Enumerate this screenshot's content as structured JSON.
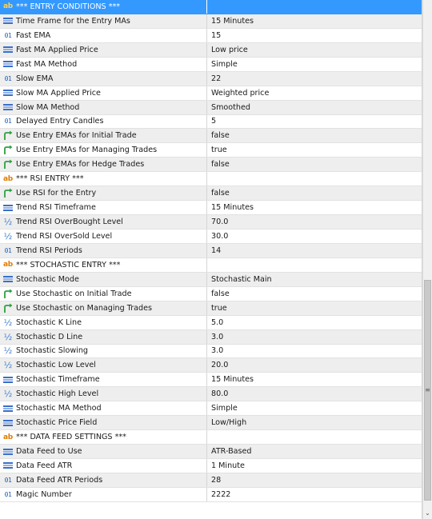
{
  "colors": {
    "selected_row": "#3399ff",
    "alt_row": "#eeeeee",
    "int_icon": "#1e5fb8",
    "bool_icon": "#2ea043",
    "string_icon": "#e07b00"
  },
  "properties": [
    {
      "icon": "string",
      "name": "*** ENTRY CONDITIONS ***",
      "value": "",
      "selected": true
    },
    {
      "icon": "enum",
      "name": "Time Frame for the Entry MAs",
      "value": "15 Minutes"
    },
    {
      "icon": "int",
      "name": "Fast EMA",
      "value": "15"
    },
    {
      "icon": "enum",
      "name": "Fast MA Applied Price",
      "value": "Low price"
    },
    {
      "icon": "enum",
      "name": "Fast MA Method",
      "value": "Simple"
    },
    {
      "icon": "int",
      "name": "Slow EMA",
      "value": "22"
    },
    {
      "icon": "enum",
      "name": "Slow MA Applied Price",
      "value": "Weighted price"
    },
    {
      "icon": "enum",
      "name": "Slow MA Method",
      "value": "Smoothed"
    },
    {
      "icon": "int",
      "name": "Delayed Entry Candles",
      "value": "5"
    },
    {
      "icon": "bool",
      "name": "Use Entry EMAs for Initial Trade",
      "value": "false"
    },
    {
      "icon": "bool",
      "name": "Use Entry EMAs for Managing Trades",
      "value": "true"
    },
    {
      "icon": "bool",
      "name": "Use Entry EMAs for Hedge Trades",
      "value": "false"
    },
    {
      "icon": "string",
      "name": "*** RSI ENTRY ***",
      "value": ""
    },
    {
      "icon": "bool",
      "name": "Use RSI for the Entry",
      "value": "false"
    },
    {
      "icon": "enum",
      "name": "Trend RSI Timeframe",
      "value": "15 Minutes"
    },
    {
      "icon": "double",
      "name": "Trend RSI OverBought Level",
      "value": "70.0"
    },
    {
      "icon": "double",
      "name": "Trend RSI OverSold Level",
      "value": "30.0"
    },
    {
      "icon": "int",
      "name": "Trend RSI Periods",
      "value": "14"
    },
    {
      "icon": "string",
      "name": "*** STOCHASTIC ENTRY ***",
      "value": ""
    },
    {
      "icon": "enum",
      "name": "Stochastic Mode",
      "value": "Stochastic Main"
    },
    {
      "icon": "bool",
      "name": "Use Stochastic on Initial Trade",
      "value": "false"
    },
    {
      "icon": "bool",
      "name": "Use Stochastic on Managing Trades",
      "value": "true"
    },
    {
      "icon": "double",
      "name": "Stochastic K Line",
      "value": "5.0"
    },
    {
      "icon": "double",
      "name": "Stochastic D Line",
      "value": "3.0"
    },
    {
      "icon": "double",
      "name": "Stochastic Slowing",
      "value": "3.0"
    },
    {
      "icon": "double",
      "name": "Stochastic Low Level",
      "value": "20.0"
    },
    {
      "icon": "enum",
      "name": "Stochastic Timeframe",
      "value": "15 Minutes"
    },
    {
      "icon": "double",
      "name": "Stochastic High Level",
      "value": "80.0"
    },
    {
      "icon": "enum",
      "name": "Stochastic MA Method",
      "value": "Simple"
    },
    {
      "icon": "enum",
      "name": "Stochastic Price Field",
      "value": "Low/High"
    },
    {
      "icon": "string",
      "name": "*** DATA FEED SETTINGS ***",
      "value": ""
    },
    {
      "icon": "enum",
      "name": "Data Feed to Use",
      "value": "ATR-Based"
    },
    {
      "icon": "enum",
      "name": "Data Feed ATR",
      "value": "1 Minute"
    },
    {
      "icon": "int",
      "name": "Data Feed ATR Periods",
      "value": "28"
    },
    {
      "icon": "int",
      "name": "Magic Number",
      "value": "2222"
    }
  ],
  "icon_glyphs": {
    "int": "01",
    "double": "½",
    "string": "ab"
  },
  "scrollbar": {
    "grip_icon": "grip-icon",
    "down_icon": "chevron-down-icon",
    "grip_glyph": "≡",
    "down_glyph": "⌄"
  }
}
